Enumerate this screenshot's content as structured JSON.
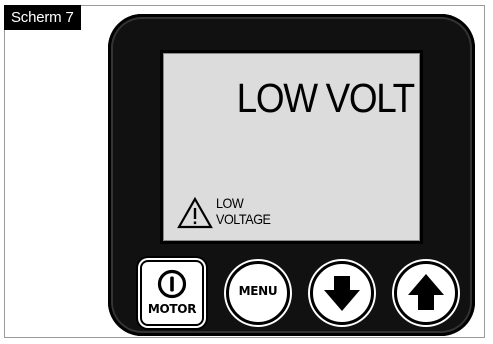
{
  "screen_label": "Scherm 7",
  "display": {
    "main_text": "LOW VOLT",
    "warning_line1": "LOW",
    "warning_line2": "VOLTAGE"
  },
  "buttons": {
    "motor_label": "MOTOR",
    "menu_label": "MENU"
  },
  "icons": {
    "warning": "warning-triangle-icon",
    "power": "power-icon",
    "down": "arrow-down-icon",
    "up": "arrow-up-icon"
  },
  "colors": {
    "device_body": "#111111",
    "lcd_background": "#dcdcdc",
    "button_face": "#ffffff",
    "label_background": "#000000"
  }
}
